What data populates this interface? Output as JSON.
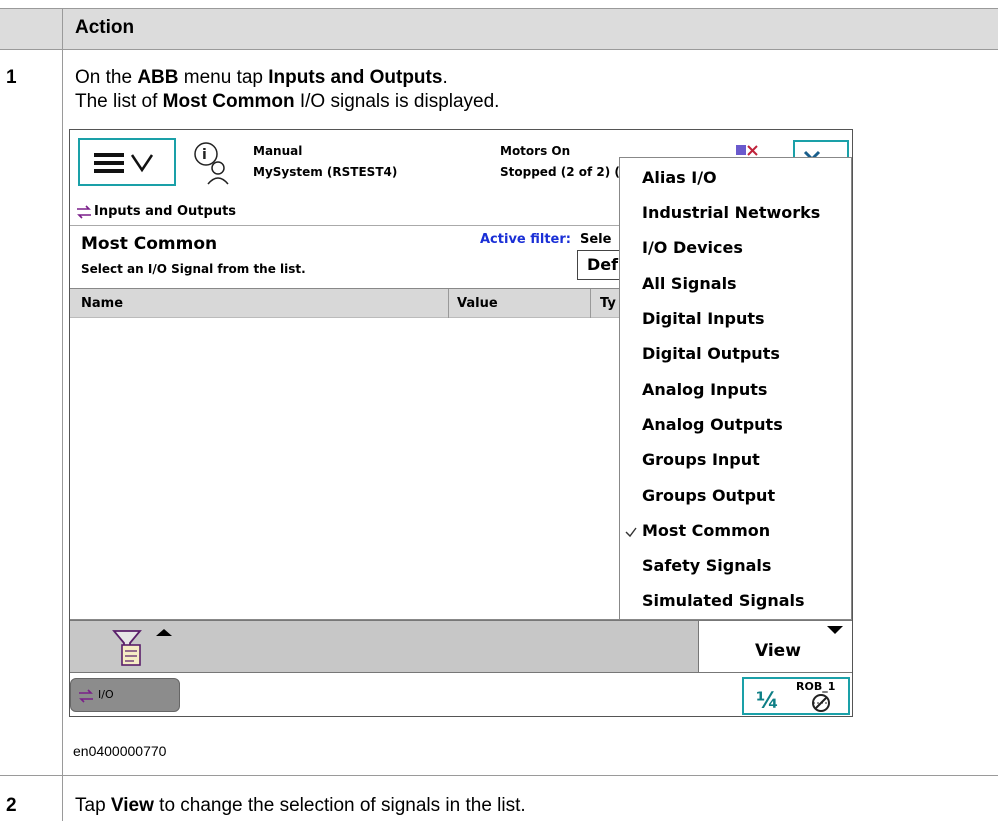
{
  "table": {
    "header_action": "Action",
    "rows": [
      {
        "step": "1",
        "line1": {
          "prefix": "On the ",
          "abb": "ABB",
          "middle": " menu tap ",
          "target": "Inputs and Outputs",
          "suffix": "."
        },
        "line2": {
          "prefix": "The list of ",
          "bold": "Most Common",
          "suffix": " I/O signals is displayed."
        },
        "figure_caption": "en0400000770"
      },
      {
        "step": "2",
        "line": {
          "prefix": "Tap ",
          "bold": "View",
          "suffix": " to change the selection of signals in the list."
        }
      }
    ]
  },
  "pendant": {
    "status": {
      "mode": "Manual",
      "system": "MySystem (RSTEST4)",
      "motors": "Motors On",
      "state": "Stopped (2 of 2) ("
    },
    "app_title": "Inputs and Outputs",
    "heading": "Most Common",
    "subheading": "Select an I/O Signal from the list.",
    "active_filter_label": "Active filter:",
    "select_label": "Sele",
    "select_value": "Def",
    "columns": {
      "name": "Name",
      "value": "Value",
      "type": "Ty"
    },
    "dropdown_items": [
      {
        "label": "Alias I/O",
        "checked": false
      },
      {
        "label": "Industrial Networks",
        "checked": false
      },
      {
        "label": "I/O Devices",
        "checked": false
      },
      {
        "label": "All Signals",
        "checked": false
      },
      {
        "label": "Digital Inputs",
        "checked": false
      },
      {
        "label": "Digital Outputs",
        "checked": false
      },
      {
        "label": "Analog Inputs",
        "checked": false
      },
      {
        "label": "Analog Outputs",
        "checked": false
      },
      {
        "label": "Groups Input",
        "checked": false
      },
      {
        "label": "Groups Output",
        "checked": false
      },
      {
        "label": "Most Common",
        "checked": true
      },
      {
        "label": "Safety Signals",
        "checked": false
      },
      {
        "label": "Simulated Signals",
        "checked": false
      }
    ],
    "view_label": "View",
    "taskbar_io": "I/O",
    "rob_label": "ROB_1",
    "increment_text": "¼",
    "accent_color": "#1aa0a8",
    "active_filter_color": "#1a2fd6"
  }
}
